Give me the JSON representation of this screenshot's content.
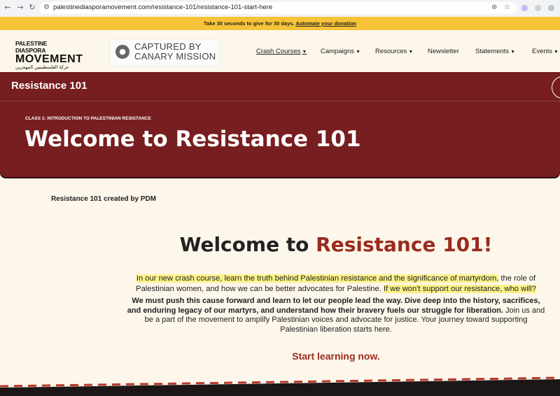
{
  "browser": {
    "url": "palestinediasporamovement.com/resistance-101/resistance-101-start-here"
  },
  "banner": {
    "text": "Take 30 seconds to give for 30 days.",
    "link": "Automate your donation"
  },
  "logo": {
    "line1": "PALESTINE DIASPORA",
    "line2": "MOVEMENT",
    "line3": "حركة الفلسطينيين المهجرين"
  },
  "canary": {
    "line1": "CAPTURED BY",
    "line2": "CANARY MISSION"
  },
  "nav": {
    "items": [
      {
        "label": "Crash Courses",
        "has_menu": true
      },
      {
        "label": "Campaigns",
        "has_menu": true
      },
      {
        "label": "Resources",
        "has_menu": true
      },
      {
        "label": "Newsletter",
        "has_menu": false
      },
      {
        "label": "Statements",
        "has_menu": true
      },
      {
        "label": "Events",
        "has_menu": true
      }
    ]
  },
  "hero": {
    "title": "Resistance 101",
    "kicker": "CLASS 1: INTRODUCTION TO PALESTINIAN RESISTANCE",
    "heading": "Welcome to Resistance 101"
  },
  "content": {
    "created_by": "Resistance 101 created by PDM",
    "heading_plain": "Welcome to",
    "heading_accent": "Resistance 101!",
    "p1_hl1": "In our new crash course, learn the truth behind Palestinian resistance and the significance of martyrdom,",
    "p1_mid": " the role of Palestinian women, and how we can be better advocates for Palestine. ",
    "p1_hl2": "If we won't support our resistance, who will?",
    "p2_bold": "We must push this cause forward and learn to let our people lead the way. Dive deep into the history, sacrifices, and enduring legacy of our martyrs, and understand how their bravery fuels our struggle for liberation.",
    "p2_rest": " Join us and be a part of the movement to amplify Palestinian voices and advocate for justice. Your journey toward supporting Palestinian liberation starts here.",
    "cta": "Start learning now."
  },
  "colors": {
    "maroon": "#771e20",
    "accent_red": "#9a2b1f",
    "banner_yellow": "#f6c338",
    "highlight": "#fbf28a",
    "page_bg": "#fdf6ea"
  }
}
